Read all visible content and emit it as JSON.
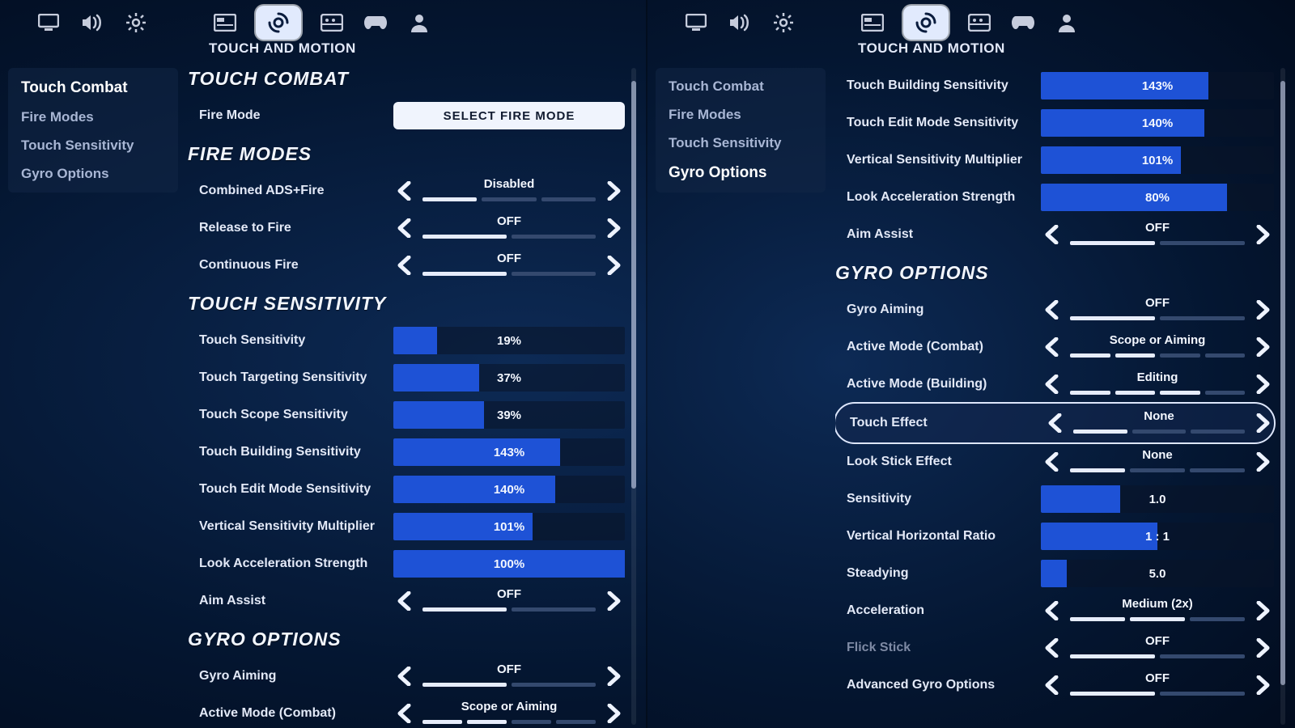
{
  "header": {
    "subtitle": "TOUCH AND MOTION"
  },
  "icons": [
    "monitor",
    "speaker",
    "gear",
    "card",
    "touch",
    "movie",
    "gamepad",
    "user"
  ],
  "left": {
    "sidebar_active": 0,
    "sidebar": [
      "Touch Combat",
      "Fire Modes",
      "Touch Sensitivity",
      "Gyro Options"
    ],
    "scroll": {
      "top_pct": 2,
      "height_pct": 62
    },
    "sections": [
      {
        "title": "TOUCH COMBAT",
        "rows": [
          {
            "label": "Fire Mode",
            "type": "button",
            "button": "SELECT FIRE MODE"
          }
        ]
      },
      {
        "title": "FIRE MODES",
        "rows": [
          {
            "label": "Combined ADS+Fire",
            "type": "selector",
            "value": "Disabled",
            "segs": 3,
            "on": 1
          },
          {
            "label": "Release to Fire",
            "type": "selector",
            "value": "OFF",
            "segs": 2,
            "on": 1
          },
          {
            "label": "Continuous Fire",
            "type": "selector",
            "value": "OFF",
            "segs": 2,
            "on": 1
          }
        ]
      },
      {
        "title": "TOUCH SENSITIVITY",
        "rows": [
          {
            "label": "Touch Sensitivity",
            "type": "slider",
            "value": "19%",
            "fill": 19
          },
          {
            "label": "Touch Targeting Sensitivity",
            "type": "slider",
            "value": "37%",
            "fill": 37
          },
          {
            "label": "Touch Scope Sensitivity",
            "type": "slider",
            "value": "39%",
            "fill": 39
          },
          {
            "label": "Touch Building Sensitivity",
            "type": "slider",
            "value": "143%",
            "fill": 72
          },
          {
            "label": "Touch Edit Mode Sensitivity",
            "type": "slider",
            "value": "140%",
            "fill": 70
          },
          {
            "label": "Vertical Sensitivity Multiplier",
            "type": "slider",
            "value": "101%",
            "fill": 60
          },
          {
            "label": "Look Acceleration Strength",
            "type": "slider",
            "value": "100%",
            "fill": 100
          },
          {
            "label": "Aim Assist",
            "type": "selector",
            "value": "OFF",
            "segs": 2,
            "on": 1
          }
        ]
      },
      {
        "title": "GYRO OPTIONS",
        "rows": [
          {
            "label": "Gyro Aiming",
            "type": "selector",
            "value": "OFF",
            "segs": 2,
            "on": 1
          },
          {
            "label": "Active Mode (Combat)",
            "type": "selector",
            "value": "Scope or Aiming",
            "segs": 4,
            "on": 2
          }
        ]
      }
    ]
  },
  "right": {
    "sidebar_active": 3,
    "sidebar": [
      "Touch Combat",
      "Fire Modes",
      "Touch Sensitivity",
      "Gyro Options"
    ],
    "scroll": {
      "top_pct": 2,
      "height_pct": 92
    },
    "sections": [
      {
        "title": "",
        "rows": [
          {
            "label": "Touch Building Sensitivity",
            "type": "slider",
            "value": "143%",
            "fill": 72
          },
          {
            "label": "Touch Edit Mode Sensitivity",
            "type": "slider",
            "value": "140%",
            "fill": 70
          },
          {
            "label": "Vertical Sensitivity Multiplier",
            "type": "slider",
            "value": "101%",
            "fill": 60
          },
          {
            "label": "Look Acceleration Strength",
            "type": "slider",
            "value": "80%",
            "fill": 80
          },
          {
            "label": "Aim Assist",
            "type": "selector",
            "value": "OFF",
            "segs": 2,
            "on": 1
          }
        ]
      },
      {
        "title": "GYRO OPTIONS",
        "rows": [
          {
            "label": "Gyro Aiming",
            "type": "selector",
            "value": "OFF",
            "segs": 2,
            "on": 1
          },
          {
            "label": "Active Mode (Combat)",
            "type": "selector",
            "value": "Scope or Aiming",
            "segs": 4,
            "on": 2
          },
          {
            "label": "Active Mode (Building)",
            "type": "selector",
            "value": "Editing",
            "segs": 4,
            "on": 3
          },
          {
            "label": "Touch Effect",
            "type": "selector",
            "value": "None",
            "segs": 3,
            "on": 1,
            "highlight": true
          },
          {
            "label": "Look Stick Effect",
            "type": "selector",
            "value": "None",
            "segs": 3,
            "on": 1
          },
          {
            "label": "Sensitivity",
            "type": "slider",
            "value": "1.0",
            "fill": 34
          },
          {
            "label": "Vertical Horizontal Ratio",
            "type": "slider",
            "value": "1 : 1",
            "fill": 50
          },
          {
            "label": "Steadying",
            "type": "slider",
            "value": "5.0",
            "fill": 11
          },
          {
            "label": "Acceleration",
            "type": "selector",
            "value": "Medium (2x)",
            "segs": 3,
            "on": 2
          },
          {
            "label": "Flick Stick",
            "type": "selector",
            "value": "OFF",
            "segs": 2,
            "on": 1,
            "dim": true
          },
          {
            "label": "Advanced Gyro Options",
            "type": "selector",
            "value": "OFF",
            "segs": 2,
            "on": 1
          }
        ]
      }
    ]
  }
}
